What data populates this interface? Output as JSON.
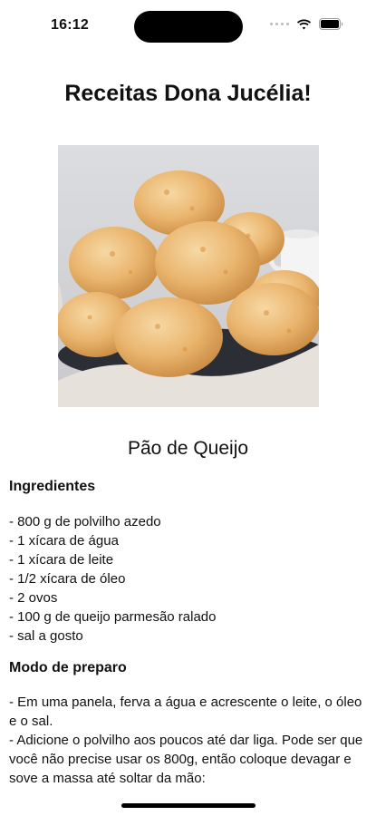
{
  "status_bar": {
    "time": "16:12",
    "icons": [
      "signal-dots-icon",
      "wifi-icon",
      "battery-icon"
    ]
  },
  "page_title": "Receitas Dona Jucélia!",
  "hero_image": {
    "subject": "pao-de-queijo-photo",
    "colors": {
      "background": "#d9d9db",
      "bread": "#e8b672",
      "cloth": "#e6e0dc",
      "plate": "#2b2f35"
    }
  },
  "recipe_name": "Pão de Queijo",
  "ingredients": {
    "heading": "Ingredientes",
    "items": [
      "- 800 g de polvilho azedo",
      "- 1 xícara de água",
      "- 1 xícara de leite",
      "- 1/2 xícara de óleo",
      "- 2 ovos",
      "- 100 g de queijo parmesão ralado",
      "- sal a gosto"
    ]
  },
  "method": {
    "heading": "Modo de preparo",
    "steps": [
      "- Em uma panela, ferva a água e acrescente o leite, o óleo e o sal.",
      "- Adicione o polvilho aos poucos até dar liga. Pode ser que você não precise usar os 800g, então coloque devagar e sove a massa até soltar da mão:"
    ]
  }
}
